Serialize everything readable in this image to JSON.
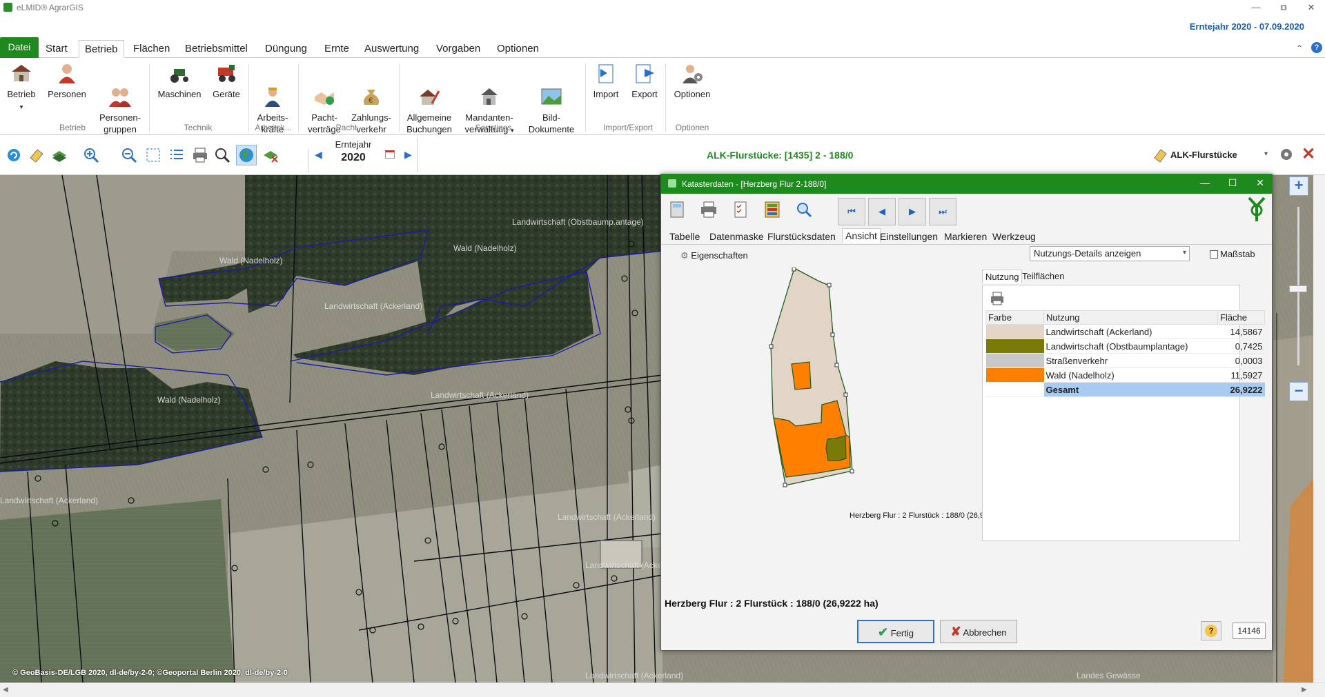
{
  "window": {
    "app_title": "eLMID® AgrarGIS",
    "season_label": "Erntejahr 2020 - 07.09.2020"
  },
  "menu": {
    "tabs": [
      "Datei",
      "Start",
      "Betrieb",
      "Flächen",
      "Betriebsmittel",
      "Düngung",
      "Ernte",
      "Auswertung",
      "Vorgaben",
      "Optionen"
    ],
    "active": "Betrieb"
  },
  "ribbon": {
    "buttons": [
      {
        "label": "Betrieb",
        "icon": "farmhouse-icon"
      },
      {
        "label": "Personen",
        "icon": "person-icon"
      },
      {
        "label": "Personen-\ngruppen",
        "icon": "people-group-icon"
      },
      {
        "label": "Maschinen",
        "icon": "tractor-icon"
      },
      {
        "label": "Geräte",
        "icon": "harvester-icon"
      },
      {
        "label": "Arbeits-\nkräfte",
        "icon": "worker-icon"
      },
      {
        "label": "Pacht-\nverträge",
        "icon": "handshake-icon"
      },
      {
        "label": "Zahlungs-\nverkehr",
        "icon": "money-bag-icon"
      },
      {
        "label": "Allgemeine\nBuchungen",
        "icon": "house-pen-icon"
      },
      {
        "label": "Mandanten-\nverwaltung",
        "icon": "houses-icon"
      },
      {
        "label": "Bild-\nDokumente",
        "icon": "picture-icon"
      },
      {
        "label": "Import",
        "icon": "import-icon"
      },
      {
        "label": "Export",
        "icon": "export-icon"
      },
      {
        "label": "Optionen",
        "icon": "options-person-gear-icon"
      }
    ],
    "groups": [
      "Betrieb",
      "Technik",
      "Arbeitsk...",
      "Pacht",
      "Sonstiges",
      "Import/Export",
      "Optionen"
    ]
  },
  "toolbar": {
    "erntejahr_label": "Erntejahr",
    "erntejahr_value": "2020",
    "alk_title": "ALK-Flurstücke: [1435]  2 - 188/0",
    "alk_layer": "ALK-Flurstücke"
  },
  "map": {
    "copyright": "© GeoBasis-DE/LGB 2020, dl-de/by-2-0; ©Geoportal Berlin 2020, dl-de/by-2-0",
    "labels": [
      "Landwirtschaft (Obstbaump.antage)",
      "Wald (Nadelholz)",
      "Wald (Nadelholz)",
      "Landwirtschaft (Ackerland)",
      "Wald (Nadelholz)",
      "Landwirtschaft (Ackerland)",
      "Landwirtschaft (Ackerland)",
      "Landwirtschaft (Ackerland)",
      "Landwirtschaft (Ackerland)",
      "Landwirtschaft (Ackerland)",
      "Landes Gewässe"
    ]
  },
  "dialog": {
    "title": "Katasterdaten - [Herzberg  Flur 2-188/0]",
    "tabs": [
      "Tabelle",
      "Datenmaske",
      "Flurstücksdaten",
      "Ansicht",
      "Einstellungen",
      "Markieren",
      "Werkzeug"
    ],
    "active_tab": "Ansicht",
    "eigenschaften": "Eigenschaften",
    "select_value": "Nutzungs-Details anzeigen",
    "massstab_label": "Maßstab",
    "right_tabs": [
      "Nutzung",
      "Teilflächen"
    ],
    "parcel_label": "Herzberg Flur : 2 Flurstück : 188/0 (26,9",
    "legend": {
      "headers": [
        "Farbe",
        "Nutzung",
        "Fläche"
      ],
      "rows": [
        {
          "color": "#e2d5c8",
          "nutzung": "Landwirtschaft (Ackerland)",
          "flaeche": "14,5867"
        },
        {
          "color": "#7a7a07",
          "nutzung": "Landwirtschaft (Obstbaumplantage)",
          "flaeche": "0,7425"
        },
        {
          "color": "#c8c8c8",
          "nutzung": "Straßenverkehr",
          "flaeche": "0,0003"
        },
        {
          "color": "#ff8000",
          "nutzung": "Wald (Nadelholz)",
          "flaeche": "11,5927"
        }
      ],
      "total": {
        "label": "Gesamt",
        "value": "26,9222"
      }
    },
    "summary": "Herzberg Flur : 2 Flurstück : 188/0 (26,9222 ha)",
    "ok_label": "Fertig",
    "cancel_label": "Abbrechen",
    "code_value": "14146"
  }
}
